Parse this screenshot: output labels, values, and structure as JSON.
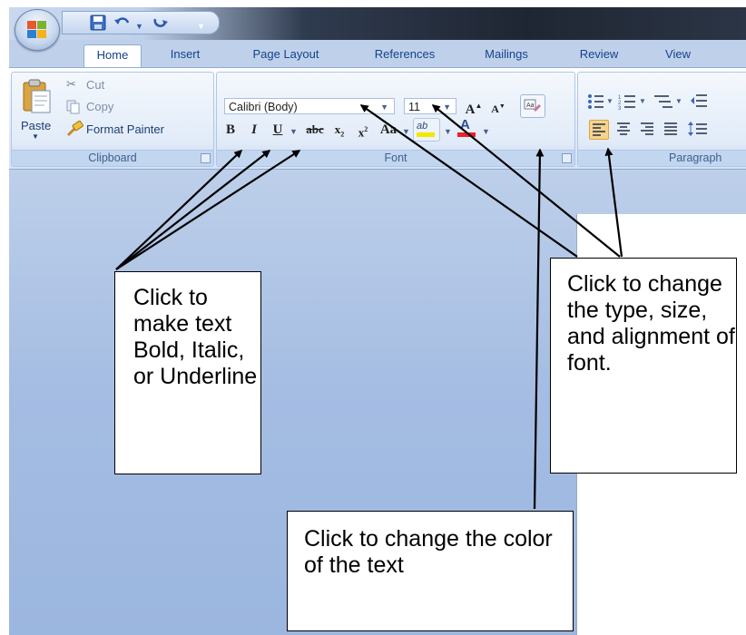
{
  "title_bar": {
    "quick_access": {
      "save_icon": "save-icon",
      "undo_icon": "undo-icon",
      "redo_icon": "redo-icon",
      "more_icon": "customize-arrow-icon"
    }
  },
  "tabs": [
    "Home",
    "Insert",
    "Page Layout",
    "References",
    "Mailings",
    "Review",
    "View"
  ],
  "clipboard": {
    "paste_label": "Paste",
    "cut_label": "Cut",
    "copy_label": "Copy",
    "format_painter_label": "Format Painter",
    "group_label": "Clipboard"
  },
  "font": {
    "font_name": "Calibri (Body)",
    "font_size": "11",
    "grow_label": "A",
    "shrink_label": "A",
    "bold_label": "B",
    "italic_label": "I",
    "underline_label": "U",
    "strike_label": "abc",
    "subscript_label": "x",
    "superscript_label": "x",
    "case_label": "Aa",
    "highlight_label": "ab",
    "font_color_label": "A",
    "group_label": "Font"
  },
  "paragraph": {
    "group_label": "Paragraph"
  },
  "callouts": {
    "format": "Click to make text Bold, Italic, or Underline",
    "type_size": "Click to change the type, size, and alignment of font.",
    "color": "Click to change the color of the text"
  },
  "colors": {
    "font_color_bar": "#e8232a",
    "highlight_bar": "#f5e600",
    "ribbon_text": "#15428b"
  }
}
